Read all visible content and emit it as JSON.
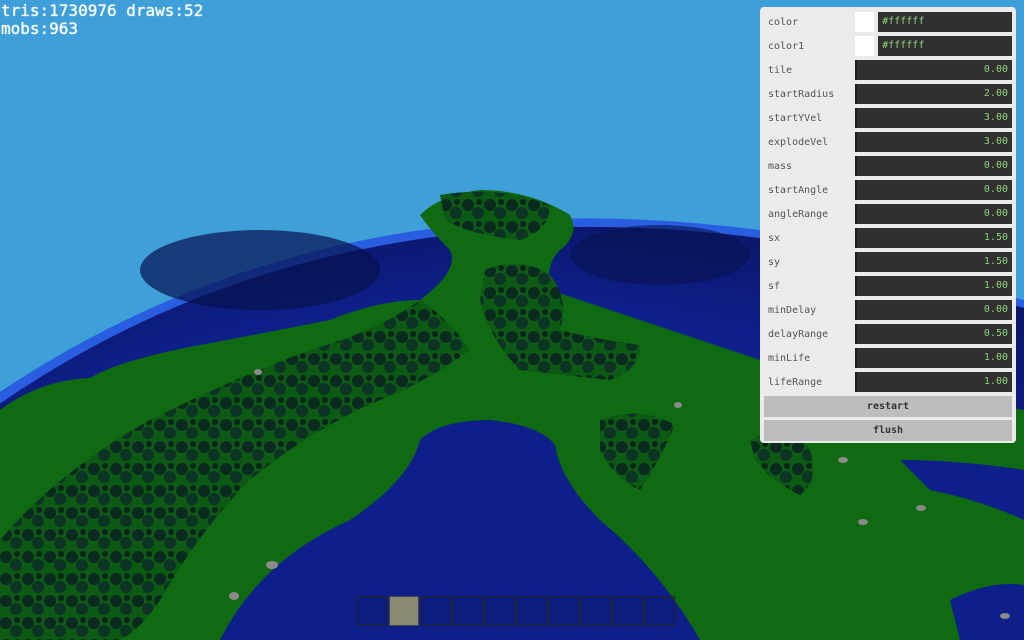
{
  "stats": {
    "line1": "tris:1730976 draws:52",
    "line2": "mobs:963"
  },
  "panel": {
    "color": {
      "label": "color",
      "value": "#ffffff"
    },
    "color1": {
      "label": "color1",
      "value": "#ffffff"
    },
    "params": [
      {
        "label": "tile",
        "value": "0.00"
      },
      {
        "label": "startRadius",
        "value": "2.00"
      },
      {
        "label": "startYVel",
        "value": "3.00"
      },
      {
        "label": "explodeVel",
        "value": "3.00"
      },
      {
        "label": "mass",
        "value": "0.00"
      },
      {
        "label": "startAngle",
        "value": "0.00"
      },
      {
        "label": "angleRange",
        "value": "0.00"
      },
      {
        "label": "sx",
        "value": "1.50"
      },
      {
        "label": "sy",
        "value": "1.50"
      },
      {
        "label": "sf",
        "value": "1.00"
      },
      {
        "label": "minDelay",
        "value": "0.00"
      },
      {
        "label": "delayRange",
        "value": "0.50"
      },
      {
        "label": "minLife",
        "value": "1.00"
      },
      {
        "label": "lifeRange",
        "value": "1.00"
      }
    ],
    "restart_label": "restart",
    "flush_label": "flush"
  },
  "hotbar": {
    "selected_slot": 2,
    "slot_count": 10
  },
  "colors": {
    "sky": "#3f9fd9",
    "ocean": "#0f1f8f",
    "land": "#0f6a12",
    "trees": "#0b2e1e"
  }
}
